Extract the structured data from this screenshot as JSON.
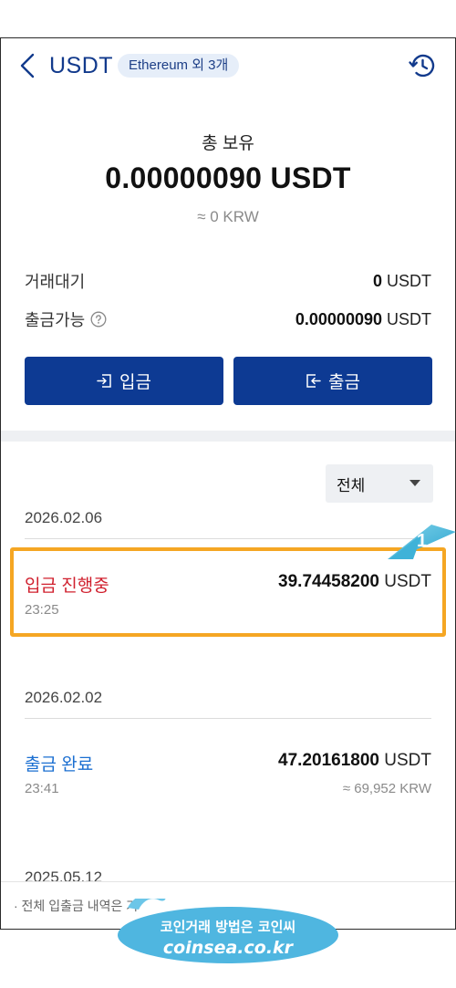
{
  "header": {
    "title": "USDT",
    "network_chip": "Ethereum 외 3개",
    "back_icon": "chevron-left-icon",
    "history_icon": "history-icon"
  },
  "balance": {
    "label": "총 보유",
    "amount": "0.00000090 USDT",
    "krw": "≈ 0 KRW"
  },
  "summary": {
    "pending_label": "거래대기",
    "pending_value": "0",
    "pending_unit": " USDT",
    "available_label": "출금가능",
    "available_value": "0.00000090",
    "available_unit": " USDT"
  },
  "actions": {
    "deposit_label": "입금",
    "withdraw_label": "출금"
  },
  "filter": {
    "selected": "전체"
  },
  "history": [
    {
      "date": "2026.02.06",
      "status": "입금 진행중",
      "status_color": "#d0202e",
      "time": "23:25",
      "amount": "39.74458200",
      "unit": " USDT",
      "krw": ""
    },
    {
      "date": "2026.02.02",
      "status": "출금 완료",
      "status_color": "#1b6fd1",
      "time": "23:41",
      "amount": "47.20161800",
      "unit": " USDT",
      "krw": "≈ 69,952 KRW"
    },
    {
      "date": "2025.05.12"
    }
  ],
  "footer": {
    "note": "· 전체 입출금 내역은 거"
  },
  "annotation": {
    "number": "1",
    "highlight_color": "#f5a623"
  },
  "watermark": {
    "line1": "코인거래 방법은 코인씨",
    "line2": "coinsea.co.kr"
  }
}
